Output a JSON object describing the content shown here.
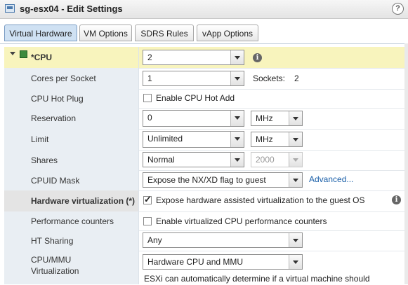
{
  "window": {
    "title": "sg-esx04 - Edit Settings",
    "help_icon": "?"
  },
  "tabs": [
    {
      "label": "Virtual Hardware",
      "active": true
    },
    {
      "label": "VM Options"
    },
    {
      "label": "SDRS Rules"
    },
    {
      "label": "vApp Options"
    }
  ],
  "cpu": {
    "label": "*CPU",
    "value": "2",
    "cores_per_socket": {
      "label": "Cores per Socket",
      "value": "1",
      "sockets_label": "Sockets:",
      "sockets_value": "2"
    },
    "hot_plug": {
      "label": "CPU Hot Plug",
      "checkbox_label": "Enable CPU Hot Add",
      "checked": false
    },
    "reservation": {
      "label": "Reservation",
      "value": "0",
      "unit": "MHz"
    },
    "limit": {
      "label": "Limit",
      "value": "Unlimited",
      "unit": "MHz"
    },
    "shares": {
      "label": "Shares",
      "value": "Normal",
      "amount": "2000"
    },
    "cpuid_mask": {
      "label": "CPUID Mask",
      "value": "Expose the NX/XD flag to guest",
      "advanced_link": "Advanced..."
    },
    "hw_virt": {
      "label": "Hardware virtualization (*)",
      "checkbox_label": "Expose hardware assisted virtualization to the guest OS",
      "checked": true
    },
    "perf_counters": {
      "label": "Performance counters",
      "checkbox_label": "Enable virtualized CPU performance counters",
      "checked": false
    },
    "ht_sharing": {
      "label": "HT Sharing",
      "value": "Any"
    },
    "cpu_mmu": {
      "label_line1": "CPU/MMU",
      "label_line2": "Virtualization",
      "value": "Hardware CPU and MMU",
      "note": "ESXi can automatically determine if a virtual machine should"
    }
  },
  "icons": {
    "window": "vm-settings-icon",
    "cpu": "cpu-chip-icon",
    "info": "info-icon"
  },
  "colors": {
    "header_row": "#f8f4bd",
    "active_tab": "#cfe1f3",
    "link": "#1a5fa8"
  }
}
